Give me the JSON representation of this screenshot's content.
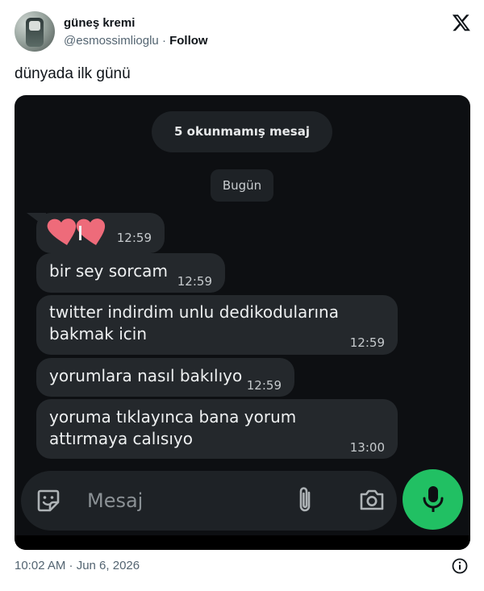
{
  "tweet": {
    "display_name": "güneş kremi",
    "handle": "@esmossimlioglu",
    "separator": "·",
    "follow_label": "Follow",
    "text": "dünyada ilk günü",
    "timestamp": "10:02 AM · Jun 6, 2026"
  },
  "chat": {
    "unread_banner": "5 okunmamış mesaj",
    "date_chip": "Bugün",
    "messages": [
      {
        "text": "",
        "time": "12:59",
        "emoji": "hearts"
      },
      {
        "text": "bir sey sorcam",
        "time": "12:59"
      },
      {
        "text": "twitter indirdim unlu dedikodularına bakmak icin",
        "time": "12:59"
      },
      {
        "text": "yorumlara nasıl bakılıyo",
        "time": "12:59"
      },
      {
        "text": "yoruma tıklayınca bana yorum attırmaya calısıyo",
        "time": "13:00"
      }
    ],
    "composer_placeholder": "Mesaj",
    "colors": {
      "background": "#0d0f12",
      "bubble": "#24282c",
      "send_button": "#21c063",
      "heart": "#ee6b7a"
    }
  },
  "icons": [
    "x-logo-icon",
    "sticker-icon",
    "paperclip-icon",
    "camera-icon",
    "microphone-icon",
    "info-icon"
  ]
}
